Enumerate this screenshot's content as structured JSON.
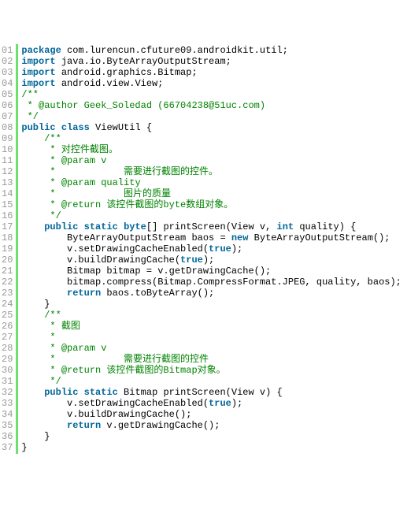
{
  "lines": [
    {
      "num": "01",
      "segs": [
        {
          "c": "kw",
          "t": "package"
        },
        {
          "c": "plain",
          "t": " com.lurencun.cfuture09.androidkit.util;"
        }
      ]
    },
    {
      "num": "02",
      "segs": [
        {
          "c": "kw",
          "t": "import"
        },
        {
          "c": "plain",
          "t": " java.io.ByteArrayOutputStream;"
        }
      ]
    },
    {
      "num": "03",
      "segs": [
        {
          "c": "kw",
          "t": "import"
        },
        {
          "c": "plain",
          "t": " android.graphics.Bitmap;"
        }
      ]
    },
    {
      "num": "04",
      "segs": [
        {
          "c": "kw",
          "t": "import"
        },
        {
          "c": "plain",
          "t": " android.view.View;"
        }
      ]
    },
    {
      "num": "05",
      "segs": [
        {
          "c": "com",
          "t": "/**"
        }
      ]
    },
    {
      "num": "06",
      "segs": [
        {
          "c": "com",
          "t": " * @author Geek_Soledad (66704238@51uc.com)"
        }
      ]
    },
    {
      "num": "07",
      "segs": [
        {
          "c": "com",
          "t": " */"
        }
      ]
    },
    {
      "num": "08",
      "segs": [
        {
          "c": "kw",
          "t": "public"
        },
        {
          "c": "plain",
          "t": " "
        },
        {
          "c": "kw",
          "t": "class"
        },
        {
          "c": "plain",
          "t": " ViewUtil {"
        }
      ]
    },
    {
      "num": "09",
      "segs": [
        {
          "c": "plain",
          "t": "    "
        },
        {
          "c": "com",
          "t": "/**"
        }
      ]
    },
    {
      "num": "10",
      "segs": [
        {
          "c": "plain",
          "t": "    "
        },
        {
          "c": "com",
          "t": " * 对控件截图。"
        }
      ]
    },
    {
      "num": "11",
      "segs": [
        {
          "c": "plain",
          "t": "    "
        },
        {
          "c": "com",
          "t": " * @param v"
        }
      ]
    },
    {
      "num": "12",
      "segs": [
        {
          "c": "plain",
          "t": "    "
        },
        {
          "c": "com",
          "t": " *            需要进行截图的控件。"
        }
      ]
    },
    {
      "num": "13",
      "segs": [
        {
          "c": "plain",
          "t": "    "
        },
        {
          "c": "com",
          "t": " * @param quality"
        }
      ]
    },
    {
      "num": "14",
      "segs": [
        {
          "c": "plain",
          "t": "    "
        },
        {
          "c": "com",
          "t": " *            图片的质量"
        }
      ]
    },
    {
      "num": "15",
      "segs": [
        {
          "c": "plain",
          "t": "    "
        },
        {
          "c": "com",
          "t": " * @return 该控件截图的byte数组对象。"
        }
      ]
    },
    {
      "num": "16",
      "segs": [
        {
          "c": "plain",
          "t": "    "
        },
        {
          "c": "com",
          "t": " */"
        }
      ]
    },
    {
      "num": "17",
      "segs": [
        {
          "c": "plain",
          "t": "    "
        },
        {
          "c": "kw",
          "t": "public"
        },
        {
          "c": "plain",
          "t": " "
        },
        {
          "c": "kw",
          "t": "static"
        },
        {
          "c": "plain",
          "t": " "
        },
        {
          "c": "kw",
          "t": "byte"
        },
        {
          "c": "plain",
          "t": "[] printScreen(View v, "
        },
        {
          "c": "kw",
          "t": "int"
        },
        {
          "c": "plain",
          "t": " quality) {"
        }
      ]
    },
    {
      "num": "18",
      "segs": [
        {
          "c": "plain",
          "t": "        ByteArrayOutputStream baos = "
        },
        {
          "c": "kw",
          "t": "new"
        },
        {
          "c": "plain",
          "t": " ByteArrayOutputStream();"
        }
      ]
    },
    {
      "num": "19",
      "segs": [
        {
          "c": "plain",
          "t": "        v.setDrawingCacheEnabled("
        },
        {
          "c": "bool",
          "t": "true"
        },
        {
          "c": "plain",
          "t": ");"
        }
      ]
    },
    {
      "num": "20",
      "segs": [
        {
          "c": "plain",
          "t": "        v.buildDrawingCache("
        },
        {
          "c": "bool",
          "t": "true"
        },
        {
          "c": "plain",
          "t": ");"
        }
      ]
    },
    {
      "num": "21",
      "segs": [
        {
          "c": "plain",
          "t": "        Bitmap bitmap = v.getDrawingCache();"
        }
      ]
    },
    {
      "num": "22",
      "segs": [
        {
          "c": "plain",
          "t": "        bitmap.compress(Bitmap.CompressFormat.JPEG, quality, baos);"
        }
      ]
    },
    {
      "num": "23",
      "segs": [
        {
          "c": "plain",
          "t": "        "
        },
        {
          "c": "kw",
          "t": "return"
        },
        {
          "c": "plain",
          "t": " baos.toByteArray();"
        }
      ]
    },
    {
      "num": "24",
      "segs": [
        {
          "c": "plain",
          "t": "    }"
        }
      ]
    },
    {
      "num": "25",
      "segs": [
        {
          "c": "plain",
          "t": "    "
        },
        {
          "c": "com",
          "t": "/**"
        }
      ]
    },
    {
      "num": "26",
      "segs": [
        {
          "c": "plain",
          "t": "    "
        },
        {
          "c": "com",
          "t": " * 截图"
        }
      ]
    },
    {
      "num": "27",
      "segs": [
        {
          "c": "plain",
          "t": "    "
        },
        {
          "c": "com",
          "t": " *"
        }
      ]
    },
    {
      "num": "28",
      "segs": [
        {
          "c": "plain",
          "t": "    "
        },
        {
          "c": "com",
          "t": " * @param v"
        }
      ]
    },
    {
      "num": "29",
      "segs": [
        {
          "c": "plain",
          "t": "    "
        },
        {
          "c": "com",
          "t": " *            需要进行截图的控件"
        }
      ]
    },
    {
      "num": "30",
      "segs": [
        {
          "c": "plain",
          "t": "    "
        },
        {
          "c": "com",
          "t": " * @return 该控件截图的Bitmap对象。"
        }
      ]
    },
    {
      "num": "31",
      "segs": [
        {
          "c": "plain",
          "t": "    "
        },
        {
          "c": "com",
          "t": " */"
        }
      ]
    },
    {
      "num": "32",
      "segs": [
        {
          "c": "plain",
          "t": "    "
        },
        {
          "c": "kw",
          "t": "public"
        },
        {
          "c": "plain",
          "t": " "
        },
        {
          "c": "kw",
          "t": "static"
        },
        {
          "c": "plain",
          "t": " Bitmap printScreen(View v) {"
        }
      ]
    },
    {
      "num": "33",
      "segs": [
        {
          "c": "plain",
          "t": "        v.setDrawingCacheEnabled("
        },
        {
          "c": "bool",
          "t": "true"
        },
        {
          "c": "plain",
          "t": ");"
        }
      ]
    },
    {
      "num": "34",
      "segs": [
        {
          "c": "plain",
          "t": "        v.buildDrawingCache();"
        }
      ]
    },
    {
      "num": "35",
      "segs": [
        {
          "c": "plain",
          "t": "        "
        },
        {
          "c": "kw",
          "t": "return"
        },
        {
          "c": "plain",
          "t": " v.getDrawingCache();"
        }
      ]
    },
    {
      "num": "36",
      "segs": [
        {
          "c": "plain",
          "t": "    }"
        }
      ]
    },
    {
      "num": "37",
      "segs": [
        {
          "c": "plain",
          "t": "}"
        }
      ]
    }
  ]
}
